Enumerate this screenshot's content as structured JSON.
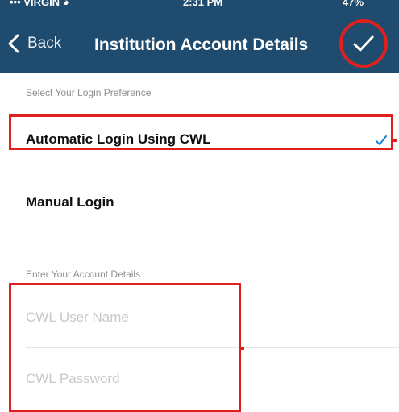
{
  "status_bar": {
    "carrier": "VIRGIN",
    "time": "2:31 PM",
    "battery": "47%"
  },
  "nav": {
    "back_label": "Back",
    "title": "Institution Account Details",
    "done_icon": "checkmark-icon"
  },
  "login_preference": {
    "header": "Select Your Login Preference",
    "options": [
      {
        "label": "Automatic Login Using CWL",
        "selected": true
      },
      {
        "label": "Manual Login",
        "selected": false
      }
    ]
  },
  "account_details": {
    "header": "Enter Your Account Details",
    "username_placeholder": "CWL User Name",
    "username_value": "",
    "password_placeholder": "CWL Password",
    "password_value": ""
  },
  "colors": {
    "nav_background": "#1f4c6e",
    "checkmark_accent": "#1a7fd1",
    "annotation_red": "#e0201f"
  }
}
